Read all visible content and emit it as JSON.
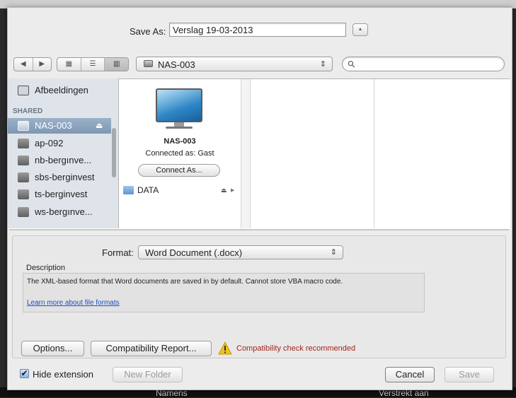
{
  "top": {
    "save_as_label": "Save As:",
    "filename_value": "Verslag 19-03-2013",
    "expand_glyph": "▲"
  },
  "toolbar": {
    "back_glyph": "◀",
    "forward_glyph": "▶",
    "view_icons_glyph": "▦",
    "view_list_glyph": "☰",
    "view_columns_glyph": "▥",
    "location_value": "NAS-003",
    "location_arrows": "⇕",
    "search_placeholder": "",
    "search_glyph": "⚲"
  },
  "sidebar": {
    "top_item": "Afbeeldingen",
    "shared_header": "SHARED",
    "items": [
      {
        "label": "NAS-003",
        "selected": true,
        "eject": "⏏"
      },
      {
        "label": "ap-092"
      },
      {
        "label": "nb-bergınve..."
      },
      {
        "label": "sbs-berginvest"
      },
      {
        "label": "ts-berginvest"
      },
      {
        "label": "ws-bergınve..."
      }
    ]
  },
  "browser": {
    "device_name": "NAS-003",
    "connected_as": "Connected as: Gast",
    "connect_button": "Connect As...",
    "folder_label": "DATA",
    "folder_eject": "⏏",
    "folder_arrow": "▶"
  },
  "format": {
    "label": "Format:",
    "value": "Word Document (.docx)",
    "arrows": "⇕",
    "description_title": "Description",
    "description_text": "The XML-based format that Word documents are saved in by default. Cannot store VBA macro code.",
    "learn_more": "Learn more about file formats"
  },
  "actions": {
    "options": "Options...",
    "compat_report": "Compatibility Report...",
    "compat_warning": "Compatibility check recommended",
    "warning_color": "#a0271c",
    "hide_extension_checked": true,
    "hide_extension": "Hide extension",
    "new_folder": "New Folder",
    "cancel": "Cancel",
    "save": "Save"
  },
  "background": {
    "left_text": "Namens",
    "right_text": "Verstrekt aan"
  }
}
